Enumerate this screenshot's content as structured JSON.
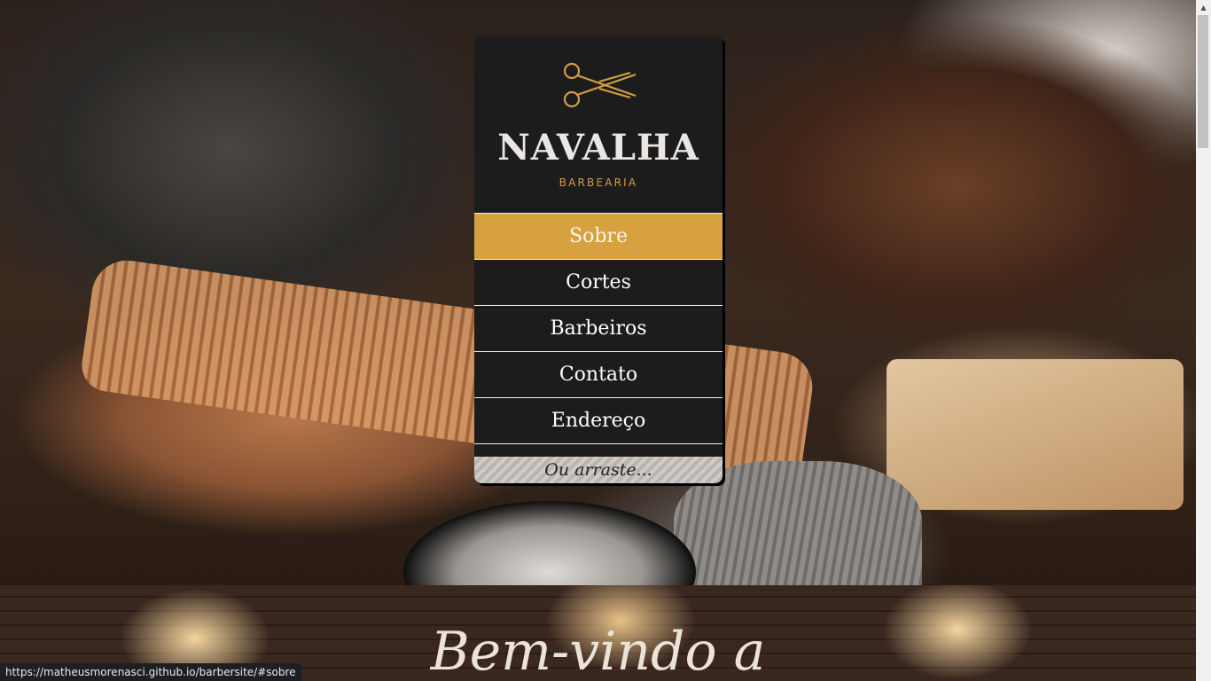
{
  "brand": {
    "name": "NAVALHA",
    "subtitle": "BARBEARIA",
    "logo_icon": "scissors-icon",
    "accent_color": "#d8a140"
  },
  "nav": {
    "items": [
      {
        "label": "Sobre",
        "active": true
      },
      {
        "label": "Cortes",
        "active": false
      },
      {
        "label": "Barbeiros",
        "active": false
      },
      {
        "label": "Contato",
        "active": false
      },
      {
        "label": "Endereço",
        "active": false
      }
    ],
    "drag_hint": "Ou arraste..."
  },
  "welcome": {
    "title": "Bem-vindo a"
  },
  "status_bar": {
    "url": "https://matheusmorenasci.github.io/barbersite/#sobre"
  }
}
